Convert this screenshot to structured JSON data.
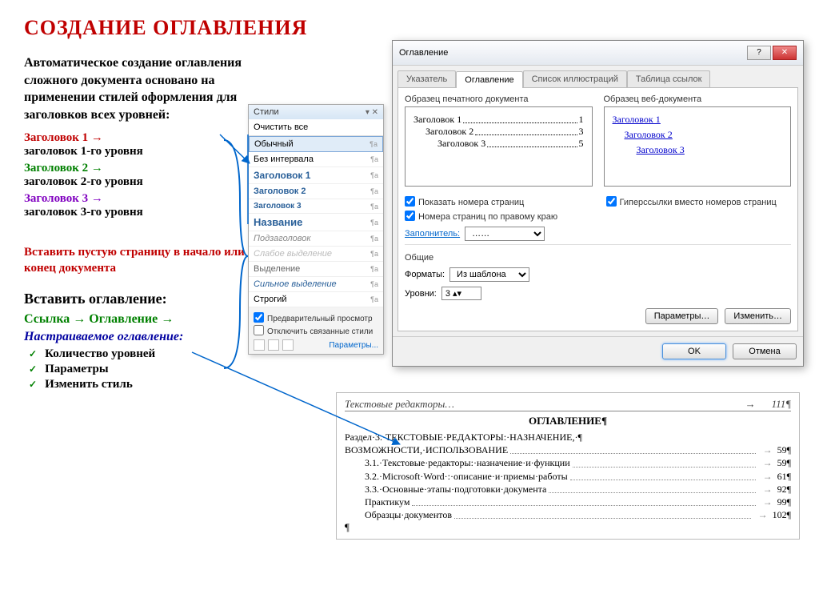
{
  "title": "СОЗДАНИЕ ОГЛАВЛЕНИЯ",
  "intro": "Автоматическое создание оглавления сложного документа основано на применении стилей оформления для заголовков всех уровней:",
  "style_map": {
    "h1_label": "Заголовок 1 →",
    "h1_desc": "заголовок 1-го уровня",
    "h2_label": "Заголовок 2 →",
    "h2_desc": "заголовок 2-го уровня",
    "h3_label": "Заголовок 3 →",
    "h3_desc": "заголовок 3-го уровня"
  },
  "insert_hint": "Вставить пустую страницу  в начало или  конец документа",
  "insert_title": "Вставить оглавление:",
  "breadcrumb": {
    "link": "Ссылка",
    "arrow": "→",
    "toc": "Оглавление",
    "arrow2": "→"
  },
  "custom_toc": "Настраиваемое оглавление:",
  "checklist": [
    "Количество уровней",
    "Параметры",
    "Изменить стиль"
  ],
  "styles_panel": {
    "title": "Стили",
    "clear": "Очистить все",
    "items": [
      {
        "name": "Обычный",
        "cls": "sel"
      },
      {
        "name": "Без интервала",
        "cls": ""
      },
      {
        "name": "Заголовок 1",
        "cls": "h1"
      },
      {
        "name": "Заголовок 2",
        "cls": "h2"
      },
      {
        "name": "Заголовок 3",
        "cls": "h3"
      },
      {
        "name": "Название",
        "cls": "name-title"
      },
      {
        "name": "Подзаголовок",
        "cls": "sub-h"
      },
      {
        "name": "Слабое выделение",
        "cls": "faint"
      },
      {
        "name": "Выделение",
        "cls": "mid"
      },
      {
        "name": "Сильное выделение",
        "cls": "strong-it"
      },
      {
        "name": "Строгий",
        "cls": ""
      }
    ],
    "preview_chk": "Предварительный просмотр",
    "disable_linked": "Отключить связанные стили",
    "params": "Параметры..."
  },
  "dialog": {
    "title": "Оглавление",
    "help": "?",
    "close": "✕",
    "tabs": [
      "Указатель",
      "Оглавление",
      "Список иллюстраций",
      "Таблица ссылок"
    ],
    "active_tab": 1,
    "print_label": "Образец печатного документа",
    "web_label": "Образец веб-документа",
    "print_lines": [
      {
        "text": "Заголовок 1",
        "indent": "",
        "page": "1"
      },
      {
        "text": "Заголовок 2",
        "indent": "l2",
        "page": "3"
      },
      {
        "text": "Заголовок 3",
        "indent": "l3",
        "page": "5"
      }
    ],
    "web_lines": [
      {
        "text": "Заголовок 1",
        "cls": ""
      },
      {
        "text": "Заголовок 2",
        "cls": "l2"
      },
      {
        "text": "Заголовок 3",
        "cls": "l3"
      }
    ],
    "chk_show_pages": "Показать номера страниц",
    "chk_right_align": "Номера страниц по правому краю",
    "chk_hyperlinks": "Гиперссылки вместо номеров страниц",
    "fill_label": "Заполнитель:",
    "fill_value": "……",
    "common": "Общие",
    "formats_label": "Форматы:",
    "formats_value": "Из шаблона",
    "levels_label": "Уровни:",
    "levels_value": "3",
    "btn_params": "Параметры…",
    "btn_modify": "Изменить…",
    "btn_ok": "OK",
    "btn_cancel": "Отмена"
  },
  "result": {
    "ruler_left": "Текстовые редакторы…",
    "ruler_right": "111¶",
    "heading": "ОГЛАВЛЕНИЕ¶",
    "lines": [
      {
        "text": "Раздел·3.·ТЕКСТОВЫЕ·РЕДАКТОРЫ:·НАЗНАЧЕНИЕ,·",
        "page": "¶",
        "nodots": true
      },
      {
        "text": "ВОЗМОЖНОСТИ,·ИСПОЛЬЗОВАНИЕ",
        "page": "59¶"
      },
      {
        "text": "3.1.·Текстовые·редакторы:·назначение·и·функции",
        "page": "59¶",
        "indent": true
      },
      {
        "text": "3.2.·Microsoft·Word·:·описание·и·приемы·работы",
        "page": "61¶",
        "indent": true
      },
      {
        "text": "3.3.·Основные·этапы·подготовки·документа",
        "page": "92¶",
        "indent": true
      },
      {
        "text": "Практикум",
        "page": "99¶",
        "indent": true
      },
      {
        "text": "Образцы·документов",
        "page": "102¶",
        "indent": true
      }
    ],
    "last": "¶"
  }
}
